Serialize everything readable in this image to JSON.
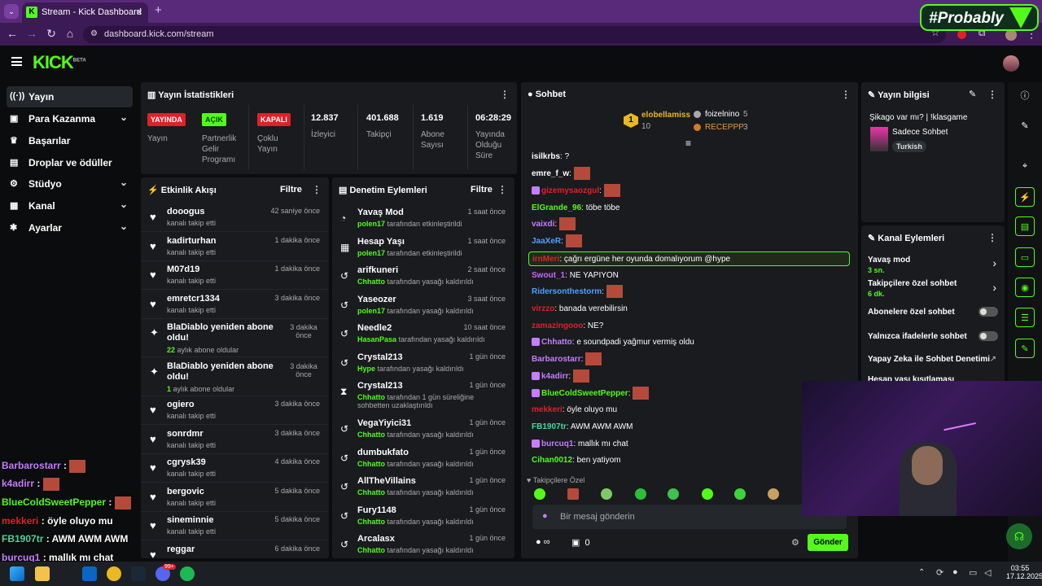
{
  "browser": {
    "tab_title": "Stream - Kick Dashboard",
    "url": "dashboard.kick.com/stream",
    "overlay_brand": "#Probably"
  },
  "app": {
    "logo": "KICK",
    "logo_sup": "BETA"
  },
  "sidebar": {
    "items": [
      {
        "label": "Yayın",
        "icon": "broadcast-icon",
        "active": true
      },
      {
        "label": "Para Kazanma",
        "icon": "money-icon",
        "chevron": true
      },
      {
        "label": "Başarılar",
        "icon": "trophy-icon"
      },
      {
        "label": "Droplar ve ödüller",
        "icon": "gift-icon"
      },
      {
        "label": "Stüdyo",
        "icon": "studio-icon",
        "chevron": true
      },
      {
        "label": "Kanal",
        "icon": "channel-icon",
        "chevron": true
      },
      {
        "label": "Ayarlar",
        "icon": "settings-icon",
        "chevron": true
      }
    ]
  },
  "stats": {
    "title": "Yayın İstatistikleri",
    "items": [
      {
        "badge": "YAYINDA",
        "color": "#e0202a",
        "label": "Yayın"
      },
      {
        "badge": "AÇIK",
        "color": "#53fc18",
        "label": "Partnerlik Gelir Programı"
      },
      {
        "badge": "KAPALI",
        "color": "#e0202a",
        "label": "Çoklu Yayın"
      },
      {
        "value": "12.837",
        "label": "İzleyici"
      },
      {
        "value": "401.688",
        "label": "Takipçi"
      },
      {
        "value": "1.619",
        "label": "Abone Sayısı"
      },
      {
        "value": "06:28:29",
        "label": "Yayında Olduğu Süre"
      }
    ]
  },
  "activity": {
    "title": "Etkinlik Akışı",
    "filter": "Filtre",
    "events": [
      {
        "name": "dooogus",
        "sub": "kanalı takip etti",
        "time": "42 saniye önce"
      },
      {
        "name": "kadirturhan",
        "sub": "kanalı takip etti",
        "time": "1 dakika önce"
      },
      {
        "name": "M07d19",
        "sub": "kanalı takip etti",
        "time": "1 dakika önce"
      },
      {
        "name": "emretcr1334",
        "sub": "kanalı takip etti",
        "time": "3 dakika önce"
      },
      {
        "name": "BlaDiablo yeniden abone oldu!",
        "sub_strong": "22",
        "sub": "aylık abone oldular",
        "time": "3 dakika önce"
      },
      {
        "name": "BlaDiablo yeniden abone oldu!",
        "sub_strong": "1",
        "sub": "aylık abone oldular",
        "time": "3 dakika önce"
      },
      {
        "name": "ogiero",
        "sub": "kanalı takip etti",
        "time": "3 dakika önce"
      },
      {
        "name": "sonrdmr",
        "sub": "kanalı takip etti",
        "time": "3 dakika önce"
      },
      {
        "name": "cgrysk39",
        "sub": "kanalı takip etti",
        "time": "4 dakika önce"
      },
      {
        "name": "bergovic",
        "sub": "kanalı takip etti",
        "time": "5 dakika önce"
      },
      {
        "name": "sineminnie",
        "sub": "kanalı takip etti",
        "time": "5 dakika önce"
      },
      {
        "name": "reggar",
        "sub": "",
        "time": "6 dakika önce"
      }
    ]
  },
  "moderation": {
    "title": "Denetim Eylemleri",
    "filter": "Filtre",
    "actions": [
      {
        "name": "Yavaş Mod",
        "by": "polen17",
        "sub": "tarafından etkinleştirildi",
        "time": "1 saat önce"
      },
      {
        "name": "Hesap Yaşı",
        "by": "polen17",
        "sub": "tarafından etkinleştirildi",
        "time": "1 saat önce"
      },
      {
        "name": "arifkuneri",
        "by": "Chhatto",
        "sub": "tarafından yasağı kaldırıldı",
        "time": "2 saat önce"
      },
      {
        "name": "Yaseozer",
        "by": "polen17",
        "sub": "tarafından yasağı kaldırıldı",
        "time": "3 saat önce"
      },
      {
        "name": "Needle2",
        "by": "HasanPasa",
        "sub": "tarafından yasağı kaldırıldı",
        "time": "10 saat önce"
      },
      {
        "name": "Crystal213",
        "by": "Hype",
        "sub": "tarafından yasağı kaldırıldı",
        "time": "1 gün önce"
      },
      {
        "name": "Crystal213",
        "by": "Chhatto",
        "sub": "tarafından 1 gün süreliğine sohbetten uzaklaştırıldı",
        "time": "1 gün önce"
      },
      {
        "name": "VegaYiyici31",
        "by": "Chhatto",
        "sub": "tarafından yasağı kaldırıldı",
        "time": "1 gün önce"
      },
      {
        "name": "dumbukfato",
        "by": "Chhatto",
        "sub": "tarafından yasağı kaldırıldı",
        "time": "1 gün önce"
      },
      {
        "name": "AllTheVillains",
        "by": "Chhatto",
        "sub": "tarafından yasağı kaldırıldı",
        "time": "1 gün önce"
      },
      {
        "name": "Fury1148",
        "by": "Chhatto",
        "sub": "tarafından yasağı kaldırıldı",
        "time": "1 gün önce"
      },
      {
        "name": "Arcalasx",
        "by": "Chhatto",
        "sub": "tarafından yasağı kaldırıldı",
        "time": "1 gün önce"
      }
    ]
  },
  "chat": {
    "title": "Sohbet",
    "leaders": {
      "rank": "1",
      "first": "elobellamiss",
      "first_count": "10",
      "second": "foizelnino",
      "second_count": "5",
      "third": "RECEPPP",
      "third_count": "3"
    },
    "messages": [
      {
        "user": "isilkrbs",
        "color": "#ffffff",
        "text": "?"
      },
      {
        "user": "emre_f_w",
        "color": "#ffffff",
        "text": ""
      },
      {
        "user": "gizemysaozgul",
        "color": "#e0202a",
        "text": ""
      },
      {
        "user": "ElGrande_96",
        "color": "#53fc18",
        "text": "töbe töbe"
      },
      {
        "user": "vaixdi",
        "color": "#c77dff",
        "text": ""
      },
      {
        "user": "JaaXeR",
        "color": "#4ea0ff",
        "text": ""
      },
      {
        "user": "irnMeri",
        "color": "#e0202a",
        "text": "çağrı ergüne her oyunda domalıyorum @hype",
        "highlight": true
      },
      {
        "user": "Swout_1",
        "color": "#c6f",
        "text": "NE YAPIYON"
      },
      {
        "user": "Ridersonthestorm",
        "color": "#4ea0ff",
        "text": ""
      },
      {
        "user": "virzzo",
        "color": "#e0202a",
        "text": "banada verebilirsin"
      },
      {
        "user": "zamazingooo",
        "color": "#e0202a",
        "text": "ΝΕ?"
      },
      {
        "user": "Chhatto",
        "color": "#c77dff",
        "text": "e soundpadi yağmur vermiş oldu"
      },
      {
        "user": "Barbarostarr",
        "color": "#c77dff",
        "text": ""
      },
      {
        "user": "k4adirr",
        "color": "#c77dff",
        "text": ""
      },
      {
        "user": "BlueColdSweetPepper",
        "color": "#53fc18",
        "text": ""
      },
      {
        "user": "mekkeri",
        "color": "#e0202a",
        "text": "öyle oluyo mu"
      },
      {
        "user": "FB1907tr",
        "color": "#4ed6a0",
        "text": "AWM AWM AWM"
      },
      {
        "user": "burcuq1",
        "color": "#c77dff",
        "text": "mallık mı chat"
      },
      {
        "user": "Cihan0012",
        "color": "#53fc18",
        "text": "ben yatiyom"
      }
    ],
    "followers_only": "Takipçilere Özel",
    "input_placeholder": "Bir mesaj gönderin",
    "send_label": "Gönder",
    "points": "0",
    "infinity": "∞"
  },
  "stream_info": {
    "title": "Yayın bilgisi",
    "stream_title": "Şikago var mı? | !klasgame",
    "category": "Sadece Sohbet",
    "tag": "Turkish"
  },
  "channel_actions": {
    "title": "Kanal Eylemleri",
    "items": [
      {
        "label": "Yavaş mod",
        "sub": "3 sn.",
        "type": "chevron"
      },
      {
        "label": "Takipçilere özel sohbet",
        "sub": "6 dk.",
        "type": "chevron"
      },
      {
        "label": "Abonelere özel sohbet",
        "type": "toggle"
      },
      {
        "label": "Yalnızca ifadelerle sohbet",
        "type": "toggle"
      },
      {
        "label": "Yapay Zeka ile Sohbet Denetimi",
        "type": "external"
      },
      {
        "label": "Hesap yaşı kısıtlaması",
        "type": "external"
      }
    ]
  },
  "overlay_chat": [
    {
      "user": "Barbarostarr",
      "color": "#c77dff",
      "text": ""
    },
    {
      "user": "k4adirr",
      "color": "#c77dff",
      "text": ""
    },
    {
      "user": "BlueColdSweetPepper",
      "color": "#53fc18",
      "text": ""
    },
    {
      "user": "mekkeri",
      "color": "#e0202a",
      "text": "öyle oluyo mu"
    },
    {
      "user": "FB1907tr",
      "color": "#4ed6a0",
      "text": "AWM AWM AWM"
    },
    {
      "user": "burcuq1",
      "color": "#c77dff",
      "text": "mallık mı chat"
    }
  ],
  "taskbar": {
    "time": "03:55",
    "date": "17.12.2025",
    "discord_badge": "99+"
  }
}
